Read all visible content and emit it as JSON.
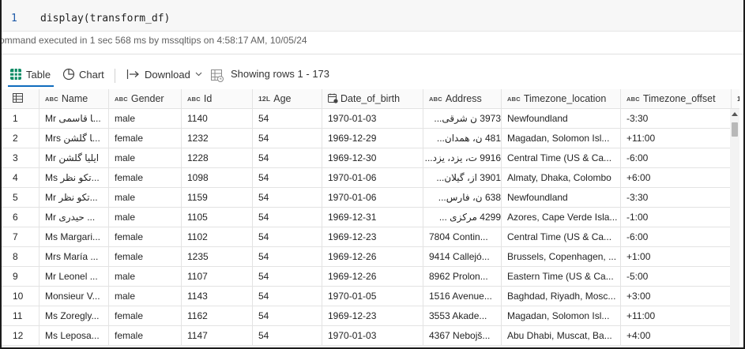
{
  "code_cell": {
    "line_number": "1",
    "code": "display(transform_df)",
    "execution_info": "ommand executed in 1 sec 568 ms by mssqltips on 4:58:17 AM, 10/05/24"
  },
  "toolbar": {
    "table_label": "Table",
    "chart_label": "Chart",
    "download_label": "Download",
    "rows_label": "Showing rows 1 - 173"
  },
  "icons": {
    "table": "table-grid-icon",
    "chart": "chart-icon",
    "download": "download-icon",
    "rows": "rows-icon",
    "row_index": "grid-icon",
    "date_type": "calendar-icon"
  },
  "colors": {
    "accent": "#0f6cbd",
    "line_number": "#1e5aa8"
  },
  "columns": [
    {
      "type": "",
      "name": ""
    },
    {
      "type": "ABC",
      "name": "Name"
    },
    {
      "type": "ABC",
      "name": "Gender"
    },
    {
      "type": "ABC",
      "name": "Id"
    },
    {
      "type": "12L",
      "name": "Age"
    },
    {
      "type": "",
      "name": "Date_of_birth"
    },
    {
      "type": "ABC",
      "name": "Address"
    },
    {
      "type": "ABC",
      "name": "Timezone_location"
    },
    {
      "type": "ABC",
      "name": "Timezone_offset"
    },
    {
      "type": "",
      "name": "1"
    }
  ],
  "rows": [
    [
      "1",
      "Mr ﺎ ﻗﺎﺳﻤﯽ...",
      "male",
      "1140",
      "54",
      "1970-01-03",
      "3973 ﻥ ﺷﺮﻗﯽ...",
      "Newfoundland",
      "-3:30"
    ],
    [
      "2",
      "Mrs ﺎ ﮔﻠﺸﻦ...",
      "female",
      "1232",
      "54",
      "1969-12-29",
      "481 ﻥ، ﻫﻤﺪﺍﻥ...",
      "Magadan, Solomon Isl...",
      "+11:00"
    ],
    [
      "3",
      "Mr ﺍﯾﻠﯿﺎ ﮔﻠﺸﻦ",
      "male",
      "1228",
      "54",
      "1969-12-30",
      "9916 ﺕ، ﯾﺰﺩ، ﯾﺰﺩ...",
      "Central Time (US & Ca...",
      "-6:00"
    ],
    [
      "4",
      "Ms ﺗﮑﻮ ﻧﻈﺮ...",
      "female",
      "1098",
      "54",
      "1970-01-06",
      "3901 ﺍﺯ، ﮔﯿﻼﻥ...",
      "Almaty, Dhaka, Colombo",
      "+6:00"
    ],
    [
      "5",
      "Mr ﺗﮑﻮ ﻧﻈﺮ...",
      "male",
      "1159",
      "54",
      "1970-01-06",
      "638 ﻥ، ﻓﺎﺭﺱ...",
      "Newfoundland",
      "-3:30"
    ],
    [
      "6",
      "Mr ﺣﯿﺪﺭﯼ ...",
      "male",
      "1105",
      "54",
      "1969-12-31",
      "4299 ﻣﺮﮐﺰﯼ ...",
      "Azores, Cape Verde Isla...",
      "-1:00"
    ],
    [
      "7",
      "Ms Margari...",
      "female",
      "1102",
      "54",
      "1969-12-23",
      "7804 Contin...",
      "Central Time (US & Ca...",
      "-6:00"
    ],
    [
      "8",
      "Mrs María ...",
      "female",
      "1235",
      "54",
      "1969-12-26",
      "9414 Callejó...",
      "Brussels, Copenhagen, ...",
      "+1:00"
    ],
    [
      "9",
      "Mr Leonel ...",
      "male",
      "1107",
      "54",
      "1969-12-26",
      "8962 Prolon...",
      "Eastern Time (US & Ca...",
      "-5:00"
    ],
    [
      "10",
      "Monsieur V...",
      "male",
      "1143",
      "54",
      "1970-01-05",
      "1516 Avenue...",
      "Baghdad, Riyadh, Mosc...",
      "+3:00"
    ],
    [
      "11",
      "Ms Zoregly...",
      "female",
      "1162",
      "54",
      "1969-12-23",
      "3553 Akade...",
      "Magadan, Solomon Isl...",
      "+11:00"
    ],
    [
      "12",
      "Ms Leposa...",
      "female",
      "1147",
      "54",
      "1970-01-03",
      "4367 Nebojš...",
      "Abu Dhabi, Muscat, Ba...",
      "+4:00"
    ]
  ]
}
